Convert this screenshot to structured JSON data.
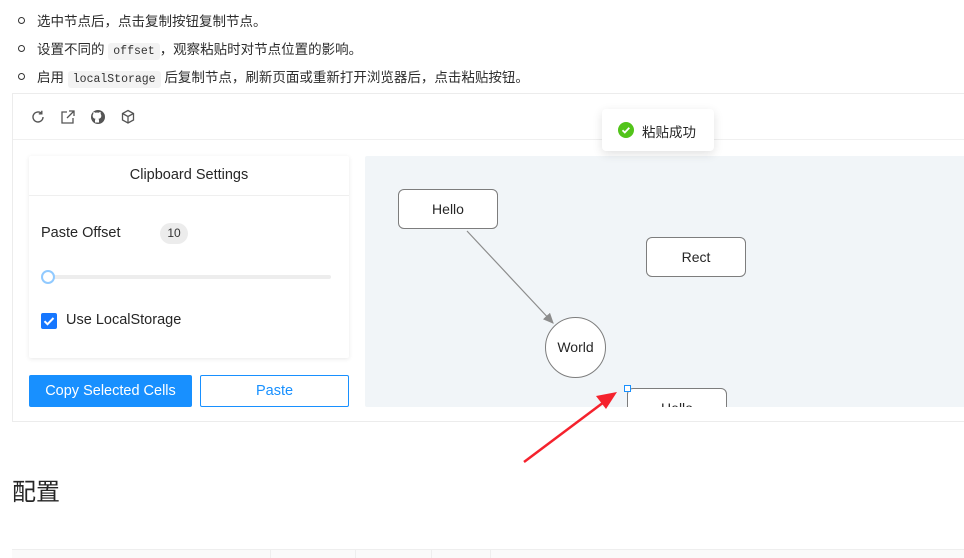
{
  "bullets": [
    {
      "before": "选中节点后，点击复制按钮复制节点。",
      "code": "",
      "after": ""
    },
    {
      "before": "设置不同的",
      "code": "offset",
      "after": "，观察粘贴时对节点位置的影响。"
    },
    {
      "before": "启用",
      "code": "localStorage",
      "after": "后复制节点，刷新页面或重新打开浏览器后，点击粘贴按钮。"
    }
  ],
  "toolbar": {
    "icons": [
      "refresh-icon",
      "open-external-icon",
      "github-icon",
      "codesandbox-icon"
    ]
  },
  "settings": {
    "title": "Clipboard Settings",
    "offset_label": "Paste Offset",
    "offset_value": "10",
    "slider_value": 0,
    "use_localstorage_label": "Use LocalStorage",
    "use_localstorage_checked": true
  },
  "buttons": {
    "copy_label": "Copy Selected Cells",
    "paste_label": "Paste"
  },
  "graph": {
    "nodes": [
      {
        "id": "hello",
        "label": "Hello",
        "shape": "rect"
      },
      {
        "id": "rect",
        "label": "Rect",
        "shape": "rect"
      },
      {
        "id": "world",
        "label": "World",
        "shape": "circle"
      },
      {
        "id": "hello-pasted",
        "label": "Hello",
        "shape": "rect"
      }
    ],
    "edges": [
      {
        "from": "hello",
        "to": "world"
      }
    ]
  },
  "toast": {
    "text": "粘贴成功",
    "status": "success"
  },
  "section": {
    "title": "配置"
  },
  "colors": {
    "primary": "#1890ff",
    "success": "#52c41a",
    "canvas_bg": "#f1f5f8",
    "annotation_arrow": "#f5222d"
  }
}
